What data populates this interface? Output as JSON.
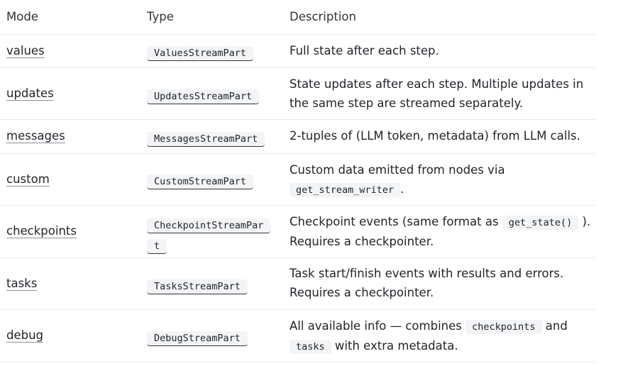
{
  "header": {
    "mode": "Mode",
    "type": "Type",
    "description": "Description"
  },
  "rows": [
    {
      "mode": "values",
      "type": "ValuesStreamPart",
      "desc": "Full state after each step."
    },
    {
      "mode": "updates",
      "type": "UpdatesStreamPart",
      "desc_line1": "State updates after each step. Multiple updates in",
      "desc_line2": "the same step are streamed separately."
    },
    {
      "mode": "messages",
      "type": "MessagesStreamPart",
      "desc": "2-tuples of (LLM token, metadata) from LLM calls."
    },
    {
      "mode": "custom",
      "type": "CustomStreamPart",
      "desc_line1": "Custom data emitted from nodes via",
      "code1": "get_stream_writer",
      "desc_after": "."
    },
    {
      "mode": "checkpoints",
      "type_part1": "CheckpointStreamPar",
      "type_part2": "t",
      "desc_before": "Checkpoint events (same format as",
      "code1": "get_state()",
      "desc_after": ").",
      "desc_line2": "Requires a checkpointer."
    },
    {
      "mode": "tasks",
      "type": "TasksStreamPart",
      "desc_line1": "Task start/finish events with results and errors.",
      "desc_line2": "Requires a checkpointer."
    },
    {
      "mode": "debug",
      "type": "DebugStreamPart",
      "desc_before": "All available info — combines",
      "code1": "checkpoints",
      "desc_mid": "and",
      "code2": "tasks",
      "desc_after": "with extra metadata."
    }
  ]
}
